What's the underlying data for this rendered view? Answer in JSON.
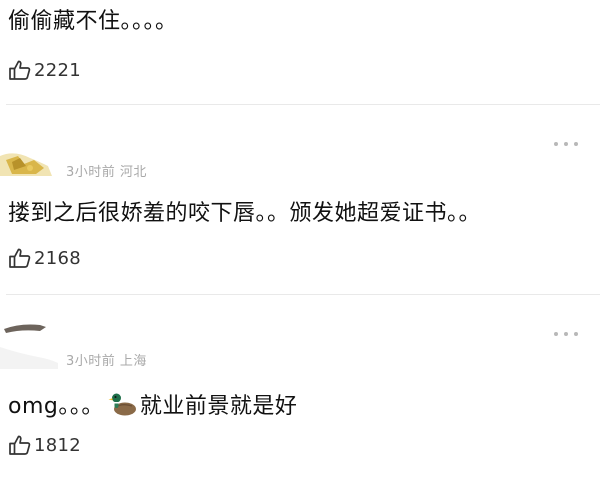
{
  "comments": [
    {
      "text": "偷偷藏不住。。。。",
      "likes": "2221"
    },
    {
      "meta": "3小时前 河北",
      "text": "搂到之后很娇羞的咬下唇。。颁发她超爱证书。。",
      "likes": "2168"
    },
    {
      "meta": "3小时前 上海",
      "text_before": "omg。。。",
      "text_after": "就业前景就是好",
      "inline_icon": "duck-emoji",
      "likes": "1812"
    }
  ],
  "icons": {
    "like": "thumbs-up-outline-icon",
    "more": "more-dots-icon"
  },
  "colors": {
    "text": "#111111",
    "meta": "#a9a9a9",
    "divider": "#e9e9e9",
    "icon": "#333333"
  }
}
